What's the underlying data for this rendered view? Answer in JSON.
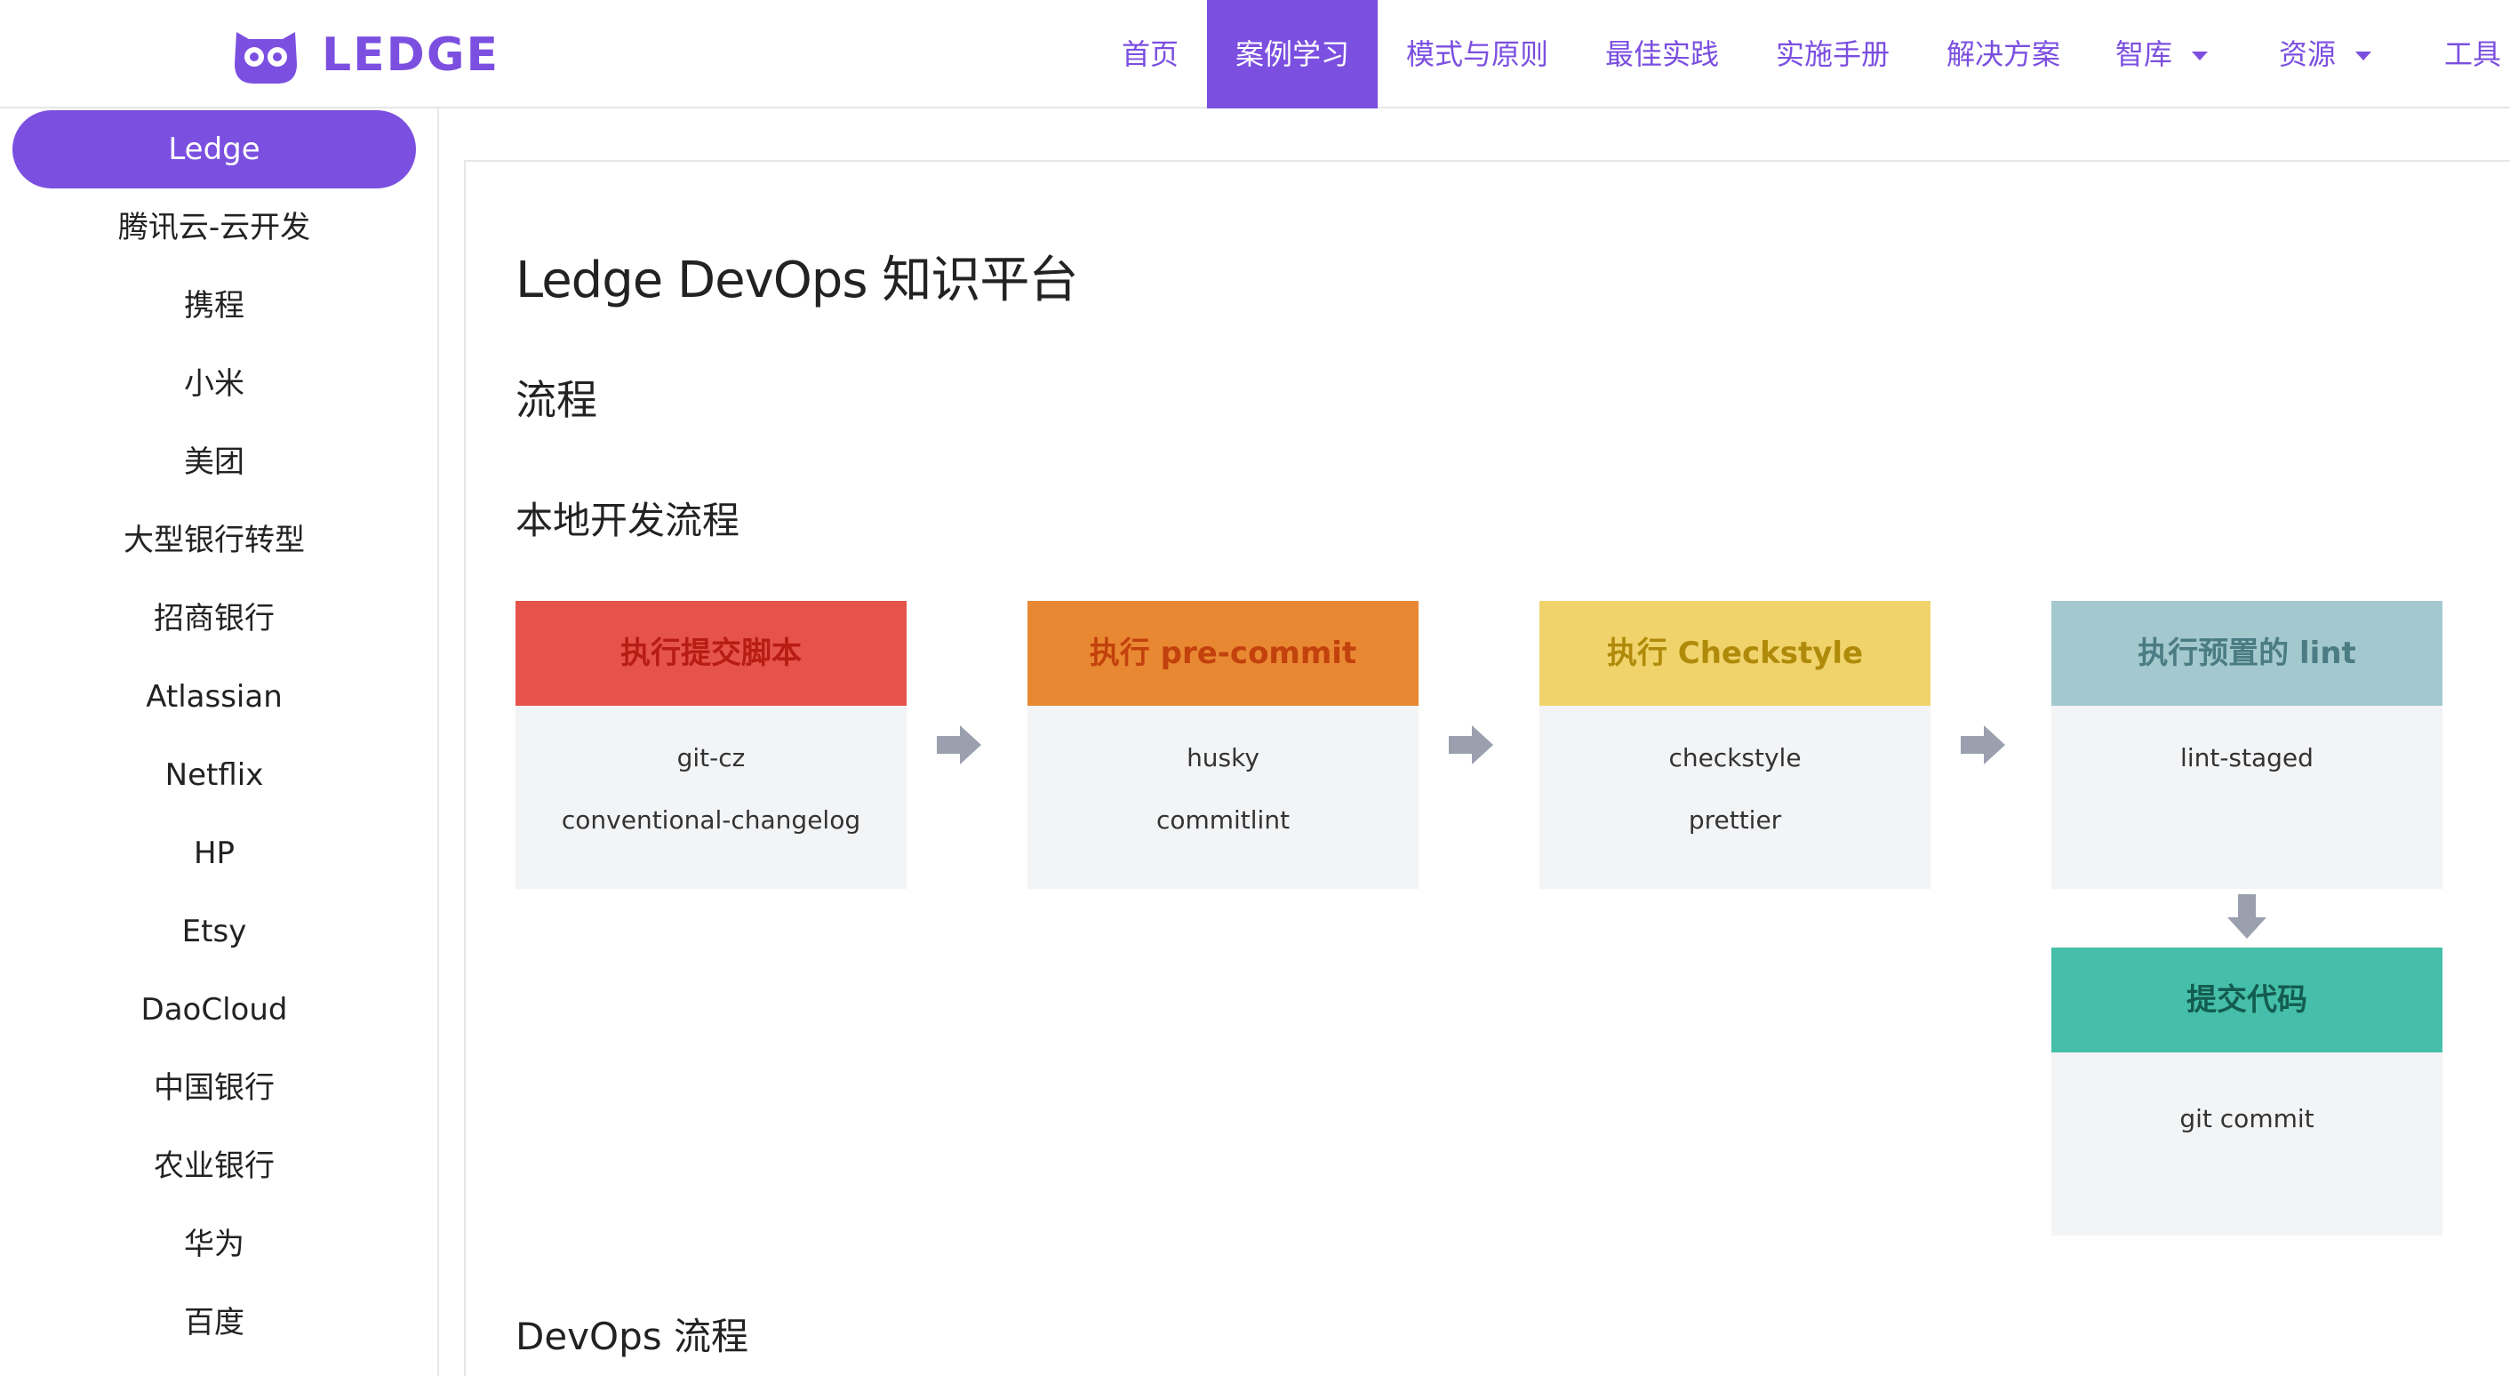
{
  "brand": {
    "name": "LEDGE",
    "color": "#7b4fe0"
  },
  "nav": {
    "items": [
      {
        "label": "首页",
        "active": false,
        "dropdown": false
      },
      {
        "label": "案例学习",
        "active": true,
        "dropdown": false
      },
      {
        "label": "模式与原则",
        "active": false,
        "dropdown": false
      },
      {
        "label": "最佳实践",
        "active": false,
        "dropdown": false
      },
      {
        "label": "实施手册",
        "active": false,
        "dropdown": false
      },
      {
        "label": "解决方案",
        "active": false,
        "dropdown": false
      },
      {
        "label": "智库",
        "active": false,
        "dropdown": true
      },
      {
        "label": "资源",
        "active": false,
        "dropdown": true
      },
      {
        "label": "工具",
        "active": false,
        "dropdown": false
      }
    ]
  },
  "sidebar": {
    "items": [
      {
        "label": "Ledge",
        "active": true
      },
      {
        "label": "腾讯云-云开发",
        "active": false
      },
      {
        "label": "携程",
        "active": false
      },
      {
        "label": "小米",
        "active": false
      },
      {
        "label": "美团",
        "active": false
      },
      {
        "label": "大型银行转型",
        "active": false
      },
      {
        "label": "招商银行",
        "active": false
      },
      {
        "label": "Atlassian",
        "active": false
      },
      {
        "label": "Netflix",
        "active": false
      },
      {
        "label": "HP",
        "active": false
      },
      {
        "label": "Etsy",
        "active": false
      },
      {
        "label": "DaoCloud",
        "active": false
      },
      {
        "label": "中国银行",
        "active": false
      },
      {
        "label": "农业银行",
        "active": false
      },
      {
        "label": "华为",
        "active": false
      },
      {
        "label": "百度",
        "active": false
      }
    ]
  },
  "content": {
    "title": "Ledge DevOps 知识平台",
    "section": "流程",
    "subsection": "本地开发流程",
    "next_subsection": "DevOps 流程",
    "cards": [
      {
        "title": "执行提交脚本",
        "lines": [
          "git-cz",
          "conventional-changelog"
        ],
        "head_color": "#e5534b",
        "text_color": "#b81c13"
      },
      {
        "title": "执行 pre-commit",
        "lines": [
          "husky",
          "commitlint"
        ],
        "head_color": "#e98833",
        "text_color": "#c2410c"
      },
      {
        "title": "执行 Checkstyle",
        "lines": [
          "checkstyle",
          "prettier"
        ],
        "head_color": "#f0d36a",
        "text_color": "#b08a0a"
      },
      {
        "title": "执行预置的 lint",
        "lines": [
          "lint-staged"
        ],
        "head_color": "#a3c9cf",
        "text_color": "#4b7c84"
      },
      {
        "title": "提交代码",
        "lines": [
          "git commit"
        ],
        "head_color": "#45bfa9",
        "text_color": "#135c50"
      }
    ],
    "arrow_color": "#9aa0ae"
  }
}
